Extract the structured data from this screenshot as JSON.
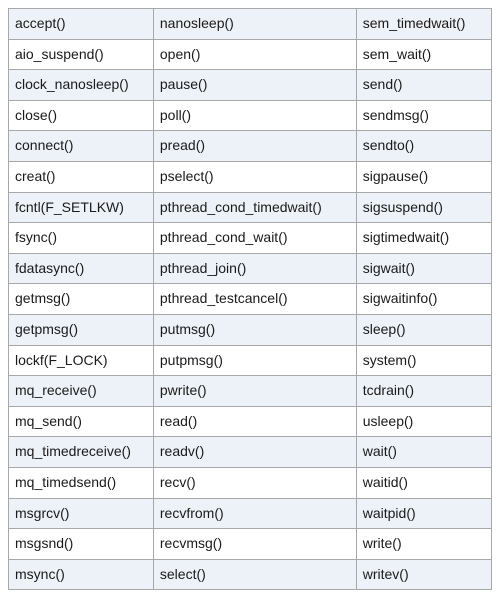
{
  "table": {
    "rows": [
      {
        "c0": "accept()",
        "c1": "nanosleep()",
        "c2": "sem_timedwait()"
      },
      {
        "c0": "aio_suspend()",
        "c1": "open()",
        "c2": "sem_wait()"
      },
      {
        "c0": "clock_nanosleep()",
        "c1": "pause()",
        "c2": "send()"
      },
      {
        "c0": "close()",
        "c1": "poll()",
        "c2": "sendmsg()"
      },
      {
        "c0": "connect()",
        "c1": "pread()",
        "c2": "sendto()"
      },
      {
        "c0": "creat()",
        "c1": "pselect()",
        "c2": "sigpause()"
      },
      {
        "c0": "fcntl(F_SETLKW)",
        "c1": "pthread_cond_timedwait()",
        "c2": "sigsuspend()"
      },
      {
        "c0": "fsync()",
        "c1": "pthread_cond_wait()",
        "c2": "sigtimedwait()"
      },
      {
        "c0": "fdatasync()",
        "c1": "pthread_join()",
        "c2": "sigwait()"
      },
      {
        "c0": "getmsg()",
        "c1": "pthread_testcancel()",
        "c2": "sigwaitinfo()"
      },
      {
        "c0": "getpmsg()",
        "c1": "putmsg()",
        "c2": "sleep()"
      },
      {
        "c0": "lockf(F_LOCK)",
        "c1": "putpmsg()",
        "c2": "system()"
      },
      {
        "c0": "mq_receive()",
        "c1": "pwrite()",
        "c2": "tcdrain()"
      },
      {
        "c0": "mq_send()",
        "c1": "read()",
        "c2": "usleep()"
      },
      {
        "c0": "mq_timedreceive()",
        "c1": "readv()",
        "c2": "wait()"
      },
      {
        "c0": "mq_timedsend()",
        "c1": "recv()",
        "c2": "waitid()"
      },
      {
        "c0": "msgrcv()",
        "c1": "recvfrom()",
        "c2": "waitpid()"
      },
      {
        "c0": "msgsnd()",
        "c1": "recvmsg()",
        "c2": "write()"
      },
      {
        "c0": "msync()",
        "c1": "select()",
        "c2": "writev()"
      }
    ]
  }
}
